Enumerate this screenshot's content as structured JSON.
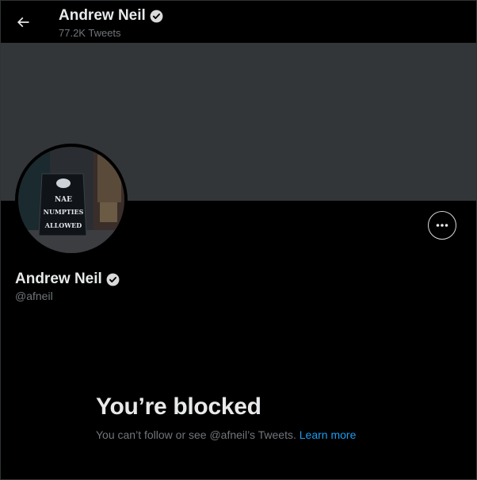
{
  "header": {
    "name": "Andrew Neil",
    "tweet_count": "77.2K Tweets",
    "back_icon": "arrow-left-icon"
  },
  "avatar_image": {
    "sign_lines": [
      "NAE",
      "NUMPTIES",
      "ALLOWED"
    ]
  },
  "profile": {
    "name": "Andrew Neil",
    "handle": "@afneil",
    "verified_icon": "verified-badge-icon",
    "more_icon": "more-options-icon"
  },
  "blocked": {
    "title": "You’re blocked",
    "message": "You can’t follow or see @afneil’s Tweets.",
    "link_label": "Learn more"
  },
  "colors": {
    "background": "#000000",
    "banner": "#333639",
    "text_primary": "#e7e9ea",
    "text_secondary": "#71767b",
    "link": "#1d9bf0"
  }
}
